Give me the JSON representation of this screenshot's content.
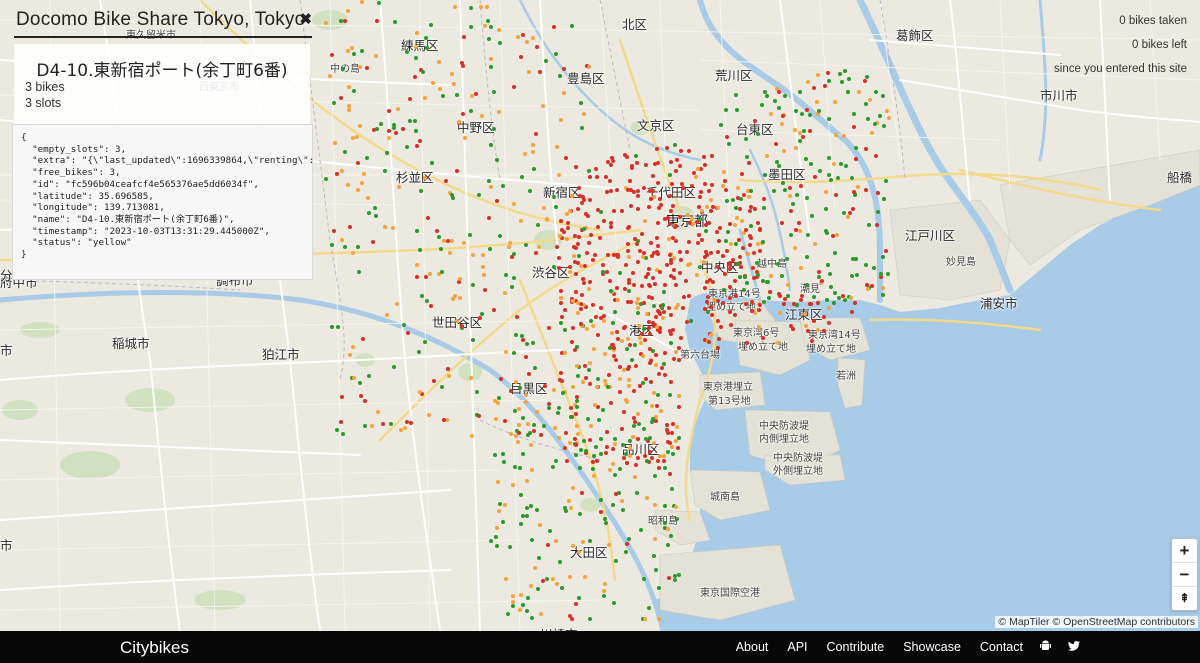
{
  "header": {
    "title": "Docomo Bike Share Tokyo, Tokyo",
    "close_glyph": "✖"
  },
  "station": {
    "name": "D4-10.東新宿ポート(余丁町6番)",
    "bikes": "3 bikes",
    "slots": "3 slots",
    "json_lines": [
      "{",
      "  \"empty_slots\": 3,",
      "  \"extra\": \"{\\\"last_updated\\\":1696339864,\\\"renting\\\":t",
      "  \"free_bikes\": 3,",
      "  \"id\": \"fc596b04ceafcf4e565376ae5dd6034f\",",
      "  \"latitude\": 35.696585,",
      "  \"longitude\": 139.713081,",
      "  \"name\": \"D4-10.東新宿ポート(余丁町6番)\",",
      "  \"timestamp\": \"2023-10-03T13:31:29.445000Z\",",
      "  \"status\": \"yellow\"",
      "}"
    ]
  },
  "stats": {
    "bikes_taken": "0 bikes taken",
    "bikes_left": "0 bikes left",
    "since": "since you entered this site"
  },
  "zoom": {
    "in": "+",
    "out": "−",
    "reset": "⇞"
  },
  "attribution": "© MapTiler © OpenStreetMap contributors",
  "footer": {
    "brand": "Citybikes",
    "links": [
      "About",
      "API",
      "Contribute",
      "Showcase",
      "Contact"
    ],
    "icons": [
      "android-icon",
      "twitter-icon"
    ]
  },
  "colors": {
    "red": "#d73027",
    "orange": "#f7a23a",
    "green": "#2a9a2a",
    "water": "#a8cbe8",
    "land": "#ece9e0"
  },
  "places": [
    {
      "t": "北区",
      "c": "ward"
    },
    {
      "t": "葛飾区",
      "c": "ward"
    },
    {
      "t": "練馬区",
      "c": "ward"
    },
    {
      "t": "東久留米市",
      "c": "small"
    },
    {
      "t": "豊島区",
      "c": "ward"
    },
    {
      "t": "荒川区",
      "c": "ward"
    },
    {
      "t": "市川市",
      "c": "ward"
    },
    {
      "t": "中の島",
      "c": "small"
    },
    {
      "t": "西東京市",
      "c": "small"
    },
    {
      "t": "中野区",
      "c": "ward"
    },
    {
      "t": "文京区",
      "c": "ward"
    },
    {
      "t": "台東区",
      "c": "ward"
    },
    {
      "t": "杉並区",
      "c": "ward"
    },
    {
      "t": "墨田区",
      "c": "ward"
    },
    {
      "t": "船橋",
      "c": "ward"
    },
    {
      "t": "新宿区",
      "c": "ward"
    },
    {
      "t": "千代田区",
      "c": "ward"
    },
    {
      "t": "東京都",
      "c": "big"
    },
    {
      "t": "江戸川区",
      "c": "ward"
    },
    {
      "t": "妙見島",
      "c": "small"
    },
    {
      "t": "渋谷区",
      "c": "ward"
    },
    {
      "t": "中央区",
      "c": "ward"
    },
    {
      "t": "越中島",
      "c": "small"
    },
    {
      "t": "府中市",
      "c": "ward"
    },
    {
      "t": "調布市",
      "c": "ward"
    },
    {
      "t": "浦安市",
      "c": "ward"
    },
    {
      "t": "東京港14号",
      "c": "small"
    },
    {
      "t": "埋め立て地",
      "c": "small"
    },
    {
      "t": "潮見",
      "c": "small"
    },
    {
      "t": "江東区",
      "c": "ward"
    },
    {
      "t": "世田谷区",
      "c": "ward"
    },
    {
      "t": "港区",
      "c": "ward"
    },
    {
      "t": "東京湾6号",
      "c": "small"
    },
    {
      "t": "埋め立て地",
      "c": "small"
    },
    {
      "t": "東京湾14号",
      "c": "small"
    },
    {
      "t": "埋め立て地",
      "c": "small"
    },
    {
      "t": "稲城市",
      "c": "ward"
    },
    {
      "t": "狛江市",
      "c": "ward"
    },
    {
      "t": "第六台場",
      "c": "small"
    },
    {
      "t": "若洲",
      "c": "small"
    },
    {
      "t": "目黒区",
      "c": "ward"
    },
    {
      "t": "東京港埋立",
      "c": "small"
    },
    {
      "t": "第13号地",
      "c": "small"
    },
    {
      "t": "中央防波堤",
      "c": "small"
    },
    {
      "t": "内側埋立地",
      "c": "small"
    },
    {
      "t": "品川区",
      "c": "ward"
    },
    {
      "t": "中央防波堤",
      "c": "small"
    },
    {
      "t": "外側埋立地",
      "c": "small"
    },
    {
      "t": "城南島",
      "c": "small"
    },
    {
      "t": "昭和島",
      "c": "small"
    },
    {
      "t": "大田区",
      "c": "ward"
    },
    {
      "t": "東京国際空港",
      "c": "small"
    },
    {
      "t": "川崎市",
      "c": "ward"
    },
    {
      "t": "市",
      "c": "ward"
    },
    {
      "t": "市",
      "c": "ward"
    },
    {
      "t": "分",
      "c": "ward"
    }
  ]
}
